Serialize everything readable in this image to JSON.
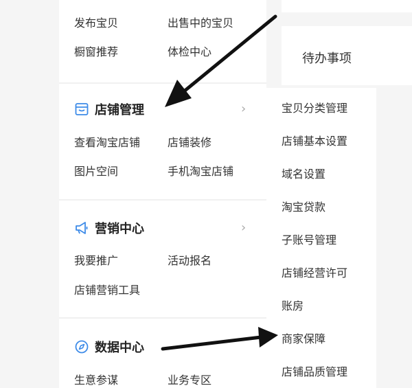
{
  "sidebar": {
    "top_links": [
      "发布宝贝",
      "出售中的宝贝",
      "橱窗推荐",
      "体检中心"
    ],
    "sections": [
      {
        "title": "店铺管理",
        "icon": "store-icon",
        "links": [
          "查看淘宝店铺",
          "店铺装修",
          "图片空间",
          "手机淘宝店铺"
        ]
      },
      {
        "title": "营销中心",
        "icon": "megaphone-icon",
        "links": [
          "我要推广",
          "活动报名",
          "店铺营销工具"
        ]
      },
      {
        "title": "数据中心",
        "icon": "compass-icon",
        "links": [
          "生意参谋",
          "业务专区"
        ]
      }
    ],
    "chevron": "›"
  },
  "main": {
    "todo_title": "待办事项"
  },
  "submenu": {
    "items": [
      "宝贝分类管理",
      "店铺基本设置",
      "域名设置",
      "淘宝贷款",
      "子账号管理",
      "店铺经营许可",
      "账房",
      "商家保障",
      "店铺品质管理"
    ]
  },
  "colors": {
    "accent": "#3d8be8",
    "arrow": "#111111"
  }
}
